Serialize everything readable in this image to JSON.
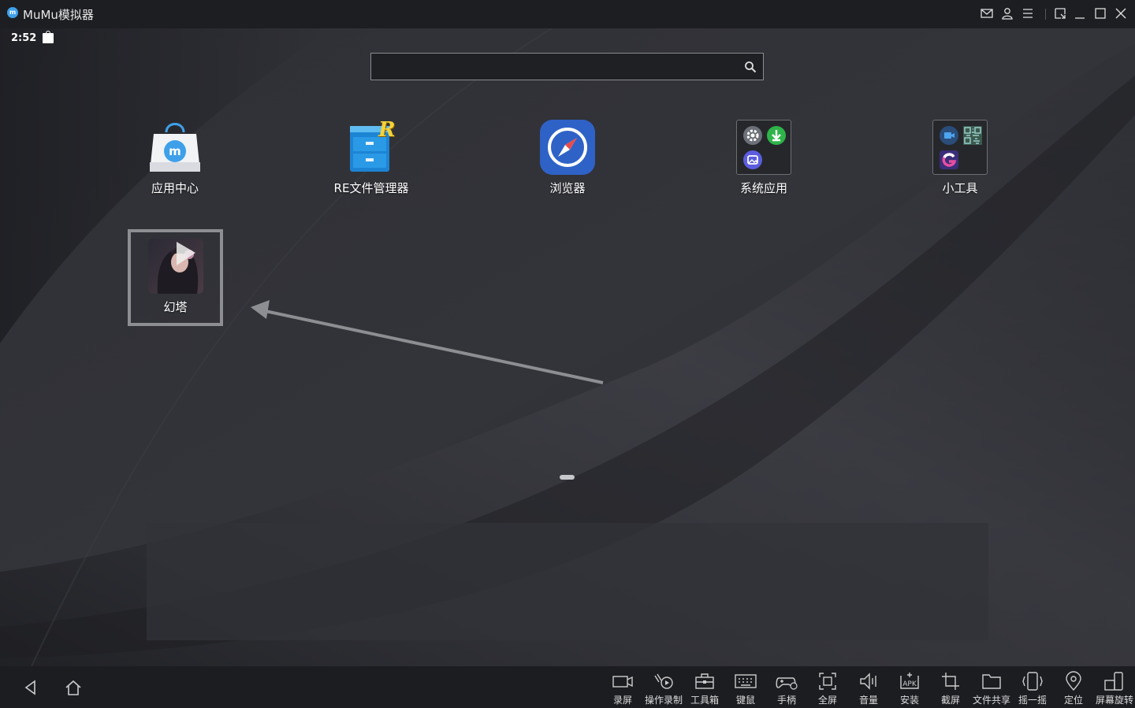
{
  "window": {
    "title": "MuMu模拟器",
    "logo_letter": "m"
  },
  "titlebar_controls": [
    "mail-icon",
    "user-icon",
    "menu-icon",
    "screen-icon",
    "minimize-icon",
    "maximize-icon",
    "close-icon"
  ],
  "statusbar": {
    "time": "2:52"
  },
  "search": {
    "placeholder": "",
    "value": ""
  },
  "apps": [
    {
      "label": "应用中心",
      "icon": "app-center-icon"
    },
    {
      "label": "RE文件管理器",
      "icon": "re-file-manager-icon",
      "icon_letter": "R"
    },
    {
      "label": "浏览器",
      "icon": "browser-compass-icon"
    },
    {
      "label": "系统应用",
      "icon": "system-apps-folder-icon"
    },
    {
      "label": "小工具",
      "icon": "tools-folder-icon"
    },
    {
      "label": "幻塔",
      "icon": "tower-of-fantasy-icon"
    }
  ],
  "toolbar": [
    {
      "label": "录屏",
      "icon": "record-screen-icon"
    },
    {
      "label": "操作录制",
      "icon": "macro-record-icon"
    },
    {
      "label": "工具箱",
      "icon": "toolbox-icon"
    },
    {
      "label": "键鼠",
      "icon": "keyboard-icon"
    },
    {
      "label": "手柄",
      "icon": "gamepad-icon"
    },
    {
      "label": "全屏",
      "icon": "fullscreen-icon"
    },
    {
      "label": "音量",
      "icon": "volume-icon"
    },
    {
      "label": "安装",
      "icon": "apk-install-icon",
      "icon_text": "APK"
    },
    {
      "label": "截屏",
      "icon": "screenshot-crop-icon"
    },
    {
      "label": "文件共享",
      "icon": "folder-share-icon"
    },
    {
      "label": "摇一摇",
      "icon": "shake-icon"
    },
    {
      "label": "定位",
      "icon": "location-pin-icon"
    },
    {
      "label": "屏幕旋转",
      "icon": "rotate-screen-icon"
    }
  ],
  "colors": {
    "accent": "#3fa0ea",
    "titlebar": "#1d1e22",
    "bottombar": "#1c1d21"
  }
}
